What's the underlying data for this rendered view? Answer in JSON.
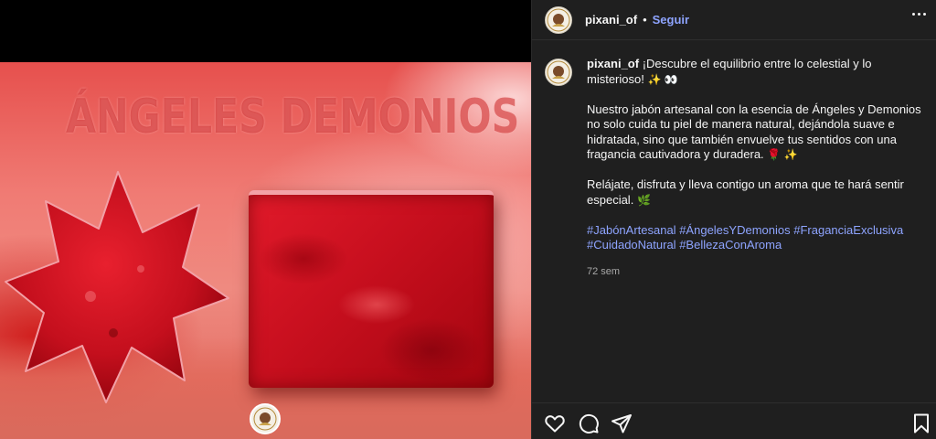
{
  "media": {
    "title_overlay": "ÁNGELES DEMONIOS"
  },
  "header": {
    "username": "pixani_of",
    "separator": "•",
    "follow_label": "Seguir"
  },
  "caption": {
    "username": "pixani_of",
    "line1": "¡Descubre el equilibrio entre lo celestial y lo misterioso!",
    "line1_emoji": "✨ 👀",
    "para2": "Nuestro jabón artesanal con la esencia de Ángeles y Demonios no solo cuida tu piel de manera natural, dejándola suave e hidratada, sino que también envuelve tus sentidos con una fragancia cautivadora y duradera.",
    "para2_emoji": "🌹 ✨",
    "para3": "Relájate, disfruta y lleva contigo un aroma que te hará sentir especial.",
    "para3_emoji": "🌿",
    "hashtags": [
      "#JabónArtesanal",
      "#ÁngelesYDemonios",
      "#FraganciaExclusiva",
      "#CuidadoNatural",
      "#BellezaConAroma"
    ],
    "time": "72 sem"
  },
  "icons": {
    "like": "heart-icon",
    "comment": "comment-icon",
    "share": "share-icon",
    "save": "bookmark-icon",
    "more": "more-dots-icon"
  },
  "colors": {
    "link": "#8ea4ff",
    "panel_bg": "#1f1f1f"
  }
}
